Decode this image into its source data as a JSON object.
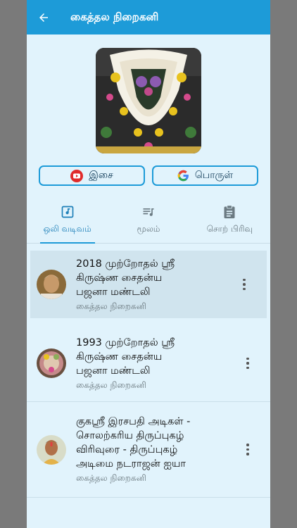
{
  "appbar": {
    "title": "கைத்தல நிறைகனி",
    "back_icon": "arrow-left-icon"
  },
  "cover": {
    "alt_icon": "deity-image"
  },
  "buttons": {
    "music_label": "இசை",
    "meaning_label": "பொருள்"
  },
  "tabs": [
    {
      "label": "ஒலி வடிவம்",
      "icon": "music-note-icon",
      "active": true
    },
    {
      "label": "மூலம்",
      "icon": "playlist-icon",
      "active": false
    },
    {
      "label": "சொற் பிரிவு",
      "icon": "clipboard-icon",
      "active": false
    }
  ],
  "tracks": [
    {
      "title_line1": "2018 முற்றோதல் ஸ்ரீ",
      "title_line2": "கிருஷ்ண சைதன்ய",
      "title_line3": "பஜனா மண்டலி",
      "subtitle": "கைத்தல நிறைகனி"
    },
    {
      "title_line1": "1993 முற்றோதல் ஸ்ரீ",
      "title_line2": "கிருஷ்ண சைதன்ய",
      "title_line3": "பஜனா மண்டலி",
      "subtitle": "கைத்தல நிறைகனி"
    },
    {
      "title_line1": "குகஸ்ரீ இரசபதி அடிகள் -",
      "title_line2": "சொலற்கரிய திருப்புகழ்",
      "title_line3": "விரிவுரை - திருப்புகழ்",
      "title_line4": "அடிமை நடராஜன் ஐயா",
      "subtitle": "கைத்தல நிறைகனி"
    }
  ],
  "colors": {
    "appbar": "#1d9bd8",
    "background": "#e1f3fc",
    "accent": "#1d9bd8"
  }
}
